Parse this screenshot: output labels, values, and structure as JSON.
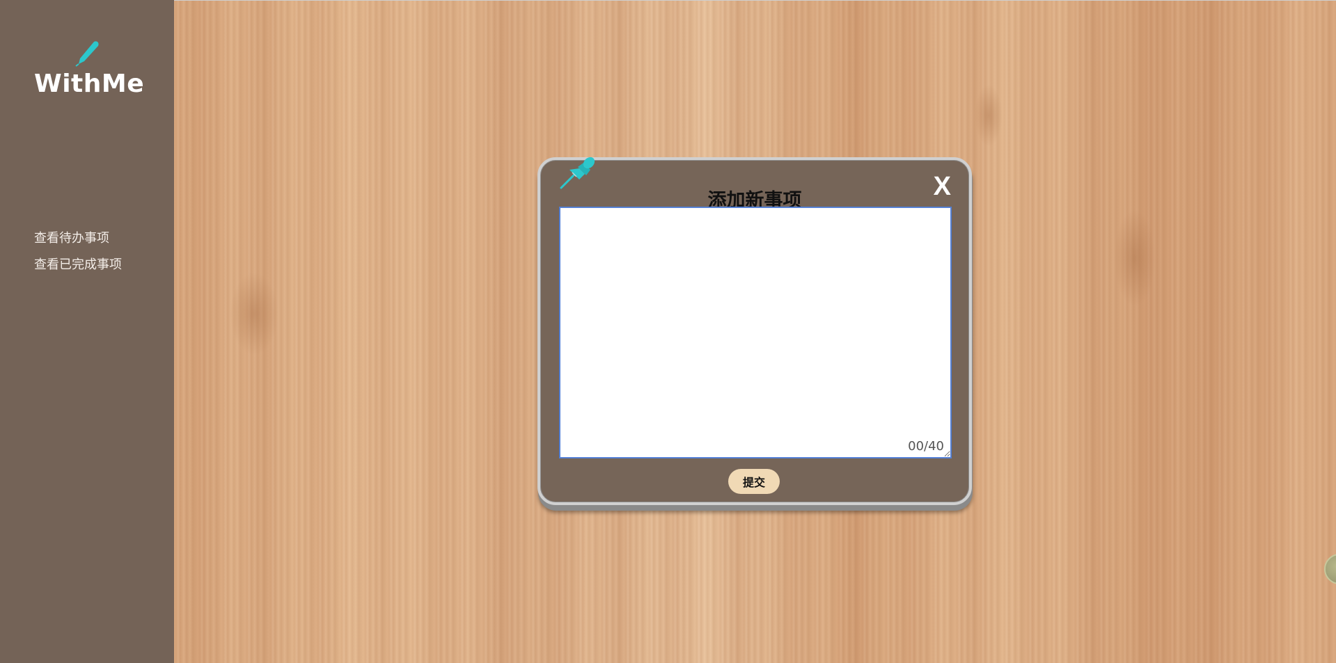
{
  "app": {
    "logo_text": "WithMe"
  },
  "sidebar": {
    "items": [
      {
        "label": "查看待办事项"
      },
      {
        "label": "查看已完成事项"
      }
    ]
  },
  "dialog": {
    "title": "添加新事项",
    "close_label": "X",
    "textarea_value": "",
    "char_count": "00/40",
    "submit_label": "提交"
  },
  "colors": {
    "sidebar_bg": "#746357",
    "dialog_bg": "#766558",
    "accent_teal": "#2cc7cc",
    "submit_bg": "#f0d9b5"
  },
  "icons": {
    "logo": "pen-icon",
    "dialog": "pushpin-icon"
  }
}
